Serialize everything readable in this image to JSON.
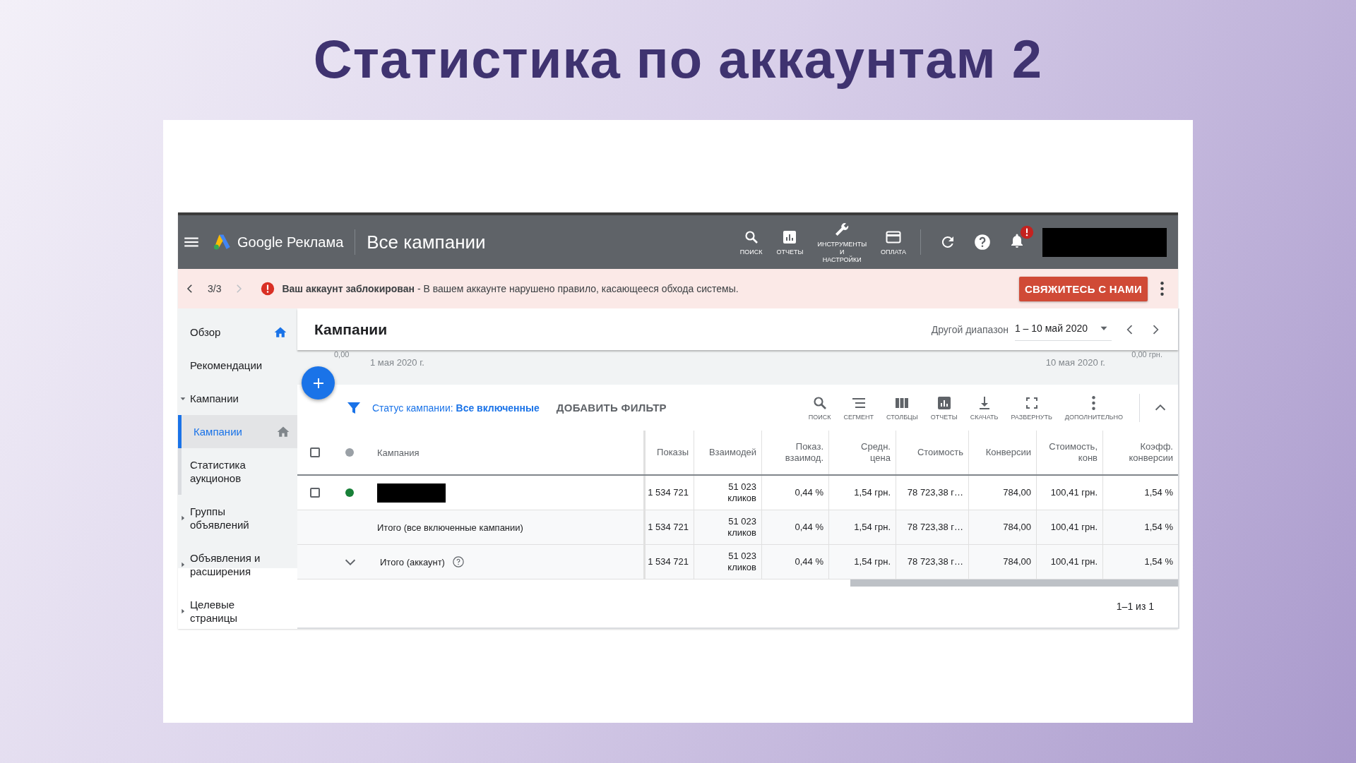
{
  "slide_title": "Статистика по аккаунтам 2",
  "top_bar": {
    "product": "Google Реклама",
    "page_title": "Все кампании",
    "notification_alert": true,
    "tools": [
      {
        "kind": "search",
        "label": "ПОИСК"
      },
      {
        "kind": "reports",
        "label": "ОТЧЕТЫ"
      },
      {
        "kind": "tools",
        "label": "ИНСТРУМЕНТЫ\nИ\nНАСТРОЙКИ"
      },
      {
        "kind": "billing",
        "label": "ОПЛАТА"
      }
    ]
  },
  "alert": {
    "counter": "3/3",
    "message": "**Ваш аккаунт заблокирован** - В вашем аккаунте нарушено правило, касающееся обхода системы.",
    "action": "СВЯЖИТЕСЬ С НАМИ"
  },
  "sidebar": {
    "items": [
      {
        "kind": "link",
        "label": "Обзор",
        "selected": false,
        "color": "#1a73e8"
      },
      {
        "kind": "link",
        "label": "Рекомендации",
        "selected": false
      },
      {
        "kind": "group",
        "label": "Кампании",
        "expanded": true,
        "children": [
          {
            "kind": "link",
            "label": "Кампании",
            "selected": true,
            "color": "#80868b"
          },
          {
            "kind": "link",
            "label": "Статистика аукционов",
            "selected": false
          }
        ]
      },
      {
        "kind": "group",
        "label": "Группы объявлений",
        "expanded": false
      },
      {
        "kind": "group",
        "label": "Объявления и расширения",
        "expanded": false
      },
      {
        "kind": "group",
        "label": "Целевые страницы",
        "expanded": false
      }
    ]
  },
  "main": {
    "title": "Кампании",
    "date_range": {
      "label": "Другой диапазон",
      "value": "1 – 10 май 2020"
    },
    "chart": {
      "left_value": "0,00",
      "start_date": "1 мая 2020 г.",
      "end_date": "10 мая 2020 г.",
      "right_value": "0,00 грн."
    },
    "filter": {
      "status": "Статус кампании: **Все включенные**",
      "add": "ДОБАВИТЬ ФИЛЬТР"
    },
    "toolbar": [
      {
        "kind": "search",
        "label": "ПОИСК"
      },
      {
        "kind": "segment",
        "label": "СЕГМЕНТ"
      },
      {
        "kind": "columns",
        "label": "СТОЛБЦЫ"
      },
      {
        "kind": "reports",
        "label": "ОТЧЕТЫ"
      },
      {
        "kind": "download",
        "label": "СКАЧАТЬ"
      },
      {
        "kind": "expand",
        "label": "РАЗВЕРНУТЬ"
      },
      {
        "kind": "more",
        "label": "ДОПОЛНИТЕЛЬНО"
      }
    ],
    "table": {
      "header": {
        "checked": false,
        "color": "#9aa0a6"
      },
      "columns": [
        "Кампания",
        "Показы",
        "Взаимодей",
        "Показ.\nвзаимод.",
        "Средн.\nцена",
        "Стоимость",
        "Конверсии",
        "Стоимость,\nконв",
        "Коэфф.\nконверсии"
      ],
      "rows": [
        {
          "kind": "campaign",
          "checked": false,
          "color": "#188038",
          "cells": [
            "",
            "1 534 721",
            "51 023\nкликов",
            "0,44 %",
            "1,54 грн.",
            "78 723,38 г…",
            "784,00",
            "100,41 грн.",
            "1,54 %"
          ]
        },
        {
          "kind": "total",
          "cells": [
            "Итого (все включенные кампании)",
            "1 534 721",
            "51 023\nкликов",
            "0,44 %",
            "1,54 грн.",
            "78 723,38 г…",
            "784,00",
            "100,41 грн.",
            "1,54 %"
          ]
        },
        {
          "kind": "account_total",
          "expanded": false,
          "cells": [
            "Итого (аккаунт)",
            "1 534 721",
            "51 023\nкликов",
            "0,44 %",
            "1,54 грн.",
            "78 723,38 г…",
            "784,00",
            "100,41 грн.",
            "1,54 %"
          ]
        }
      ]
    },
    "pagination": "1–1 из 1"
  }
}
